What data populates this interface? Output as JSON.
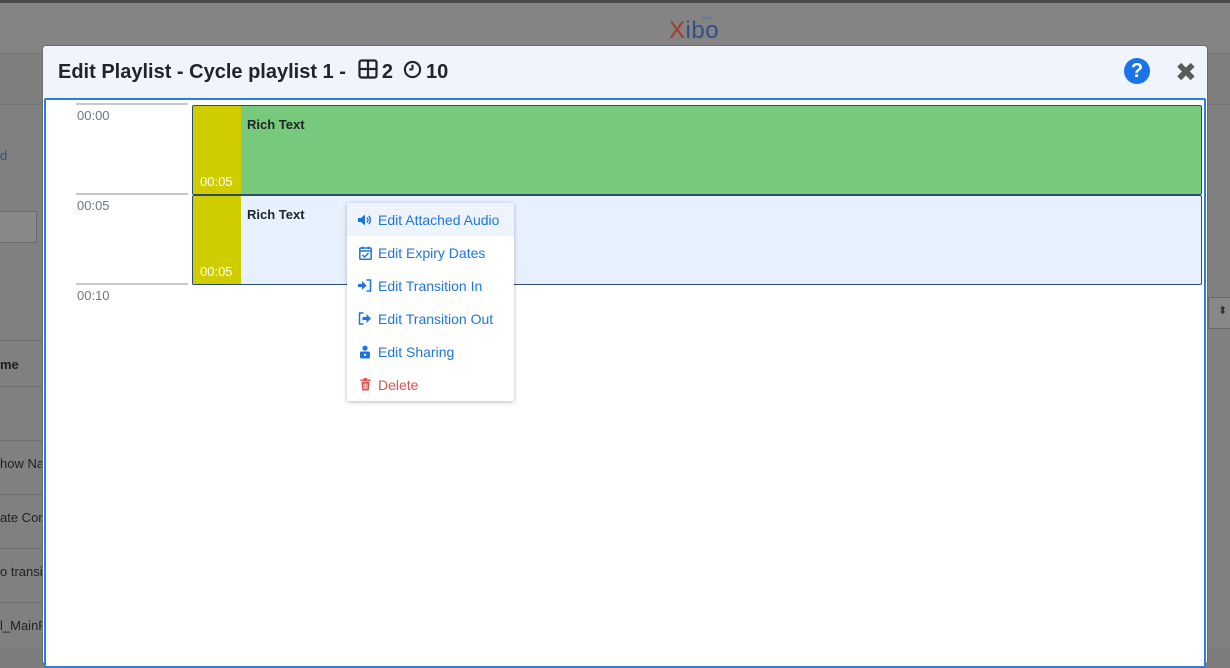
{
  "background": {
    "logo_x": "X",
    "logo_rest": "ibo",
    "left_texts": [
      "d",
      "me",
      "how Na",
      "ate Con",
      "o transi",
      "l_MainP"
    ]
  },
  "modal": {
    "title_prefix": "Edit Playlist - Cycle playlist 1 -",
    "widget_count": "2",
    "total_duration": "10",
    "help_icon_glyph": "?",
    "close_icon_glyph": "✖"
  },
  "timeline": {
    "time_labels": [
      "00:00",
      "00:05",
      "00:10"
    ],
    "widgets": [
      {
        "name": "Rich Text",
        "duration": "00:05",
        "color": "#77c97b"
      },
      {
        "name": "Rich Text",
        "duration": "00:05",
        "color": "#e7f1fd"
      }
    ],
    "duration_color": "#cfcd00"
  },
  "context_menu": {
    "items": [
      {
        "label": "Edit Attached Audio",
        "icon": "volume-icon"
      },
      {
        "label": "Edit Expiry Dates",
        "icon": "calendar-check-icon"
      },
      {
        "label": "Edit Transition In",
        "icon": "sign-in-icon"
      },
      {
        "label": "Edit Transition Out",
        "icon": "sign-out-icon"
      },
      {
        "label": "Edit Sharing",
        "icon": "user-lock-icon"
      },
      {
        "label": "Delete",
        "icon": "trash-icon"
      }
    ],
    "accent": "#1f74e0",
    "danger": "#d9534f"
  }
}
